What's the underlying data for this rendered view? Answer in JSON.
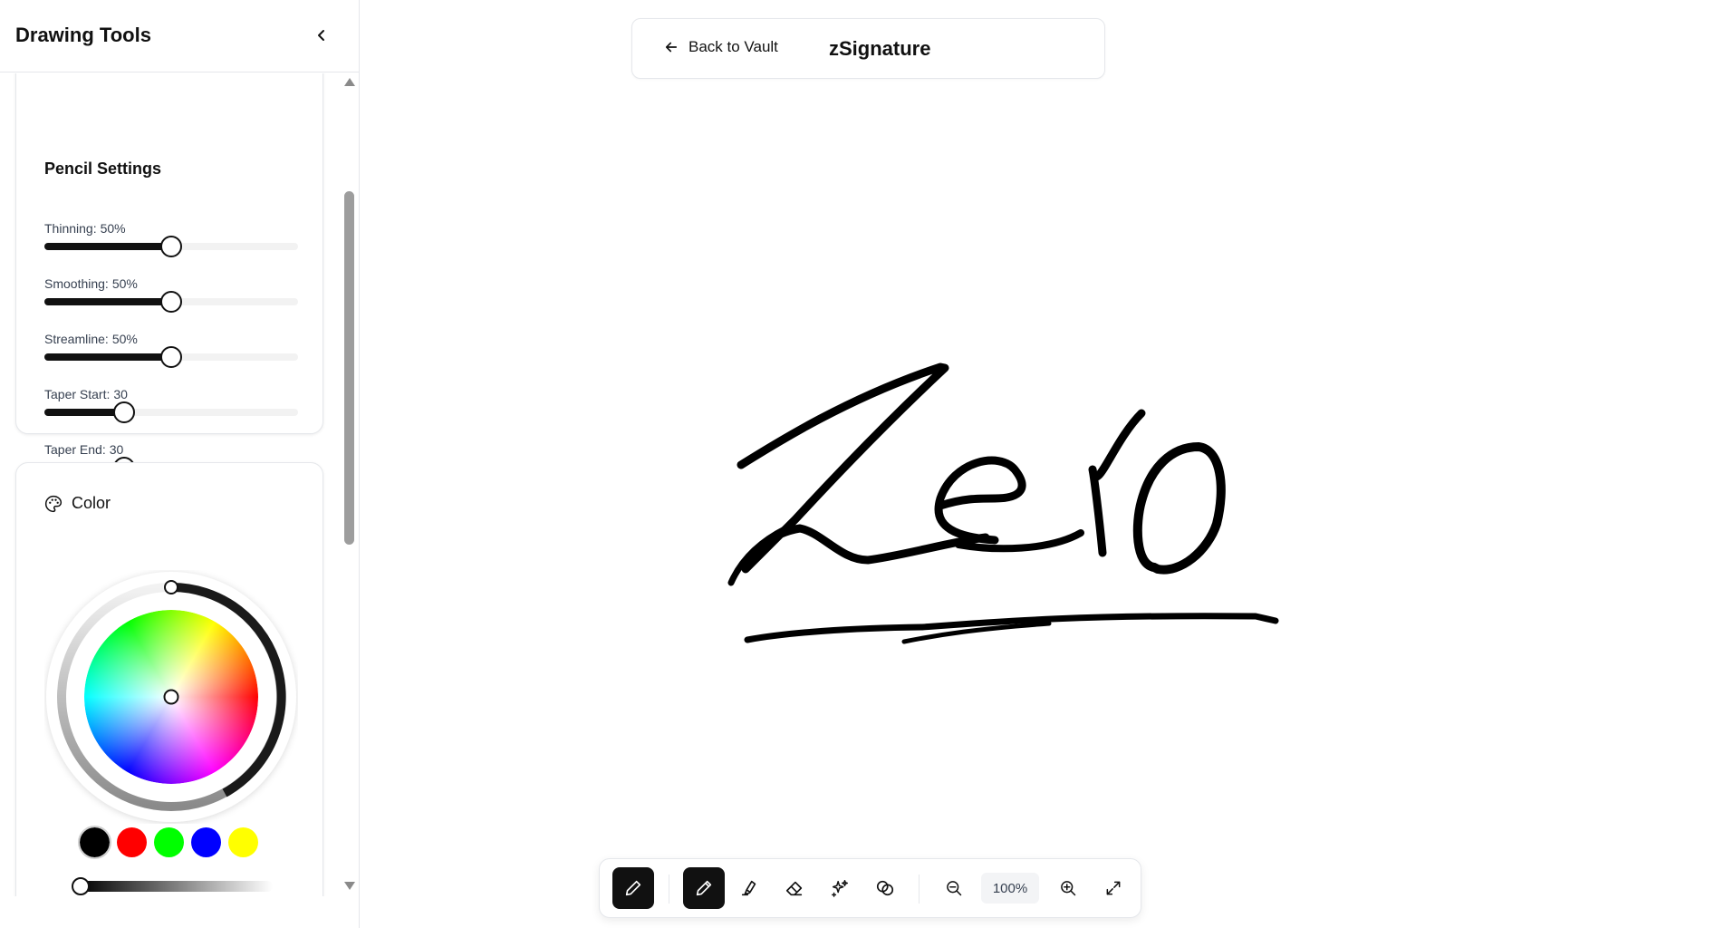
{
  "sidebar": {
    "title": "Drawing Tools",
    "pencil_settings": {
      "title": "Pencil Settings",
      "sliders": [
        {
          "label": "Thinning:",
          "value_text": "50%",
          "value": 0.5
        },
        {
          "label": "Smoothing:",
          "value_text": "50%",
          "value": 0.5
        },
        {
          "label": "Streamline:",
          "value_text": "50%",
          "value": 0.5
        },
        {
          "label": "Taper Start:",
          "value_text": "30",
          "value": 0.316
        },
        {
          "label": "Taper End:",
          "value_text": "30",
          "value": 0.316
        }
      ]
    },
    "color": {
      "title": "Color",
      "selected": "#000000",
      "swatches": [
        "#000000",
        "#ff0000",
        "#00ff00",
        "#0000ff",
        "#ffff00"
      ],
      "brightness": 0
    }
  },
  "topbar": {
    "back_label": "Back to Vault",
    "document_title": "zSignature"
  },
  "toolbar": {
    "zoom_label": "100%",
    "tools": [
      "pencil-icon",
      "pen-icon",
      "highlighter-icon",
      "eraser-icon",
      "sparkles-icon",
      "shapes-icon",
      "zoom-out-icon",
      "zoom-in-icon",
      "fullscreen-icon"
    ]
  },
  "colors": {
    "accent": "#111111",
    "border": "#e5e7eb"
  }
}
